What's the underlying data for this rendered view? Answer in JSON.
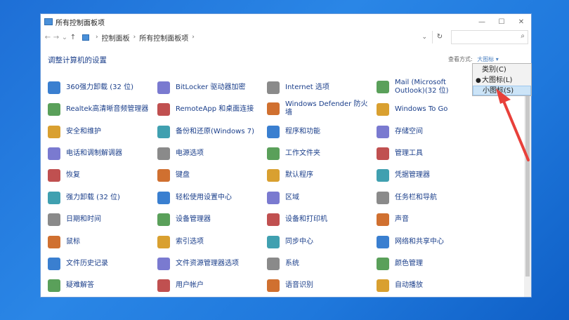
{
  "window": {
    "title": "所有控制面板项",
    "controls": {
      "minimize": "—",
      "maximize": "☐",
      "close": "✕"
    }
  },
  "address": {
    "crumbs": [
      "控制面板",
      "所有控制面板项"
    ],
    "separator": "›",
    "search_placeholder": ""
  },
  "content": {
    "heading": "调整计算机的设置",
    "view_by_label": "查看方式:",
    "view_by_value": "大图标 ▾"
  },
  "menu": {
    "items": [
      {
        "label": "类别(C)",
        "selected": false,
        "highlighted": false
      },
      {
        "label": "大图标(L)",
        "selected": true,
        "highlighted": false
      },
      {
        "label": "小图标(S)",
        "selected": false,
        "highlighted": true
      }
    ]
  },
  "items": [
    [
      "360强力卸载 (32 位)",
      "Realtek高清晰音频管理器",
      "安全和维护",
      "电话和调制解调器",
      "恢复",
      "强力卸载 (32 位)",
      "日期和时间",
      "鼠标",
      "文件历史记录",
      "疑难解答"
    ],
    [
      "BitLocker 驱动器加密",
      "RemoteApp 和桌面连接",
      "备份和还原(Windows 7)",
      "电源选项",
      "键盘",
      "轻松使用设置中心",
      "设备管理器",
      "索引选项",
      "文件资源管理器选项",
      "用户帐户"
    ],
    [
      "Internet 选项",
      "Windows Defender 防火墙",
      "程序和功能",
      "工作文件夹",
      "默认程序",
      "区域",
      "设备和打印机",
      "同步中心",
      "系统",
      "语音识别"
    ],
    [
      "Mail (Microsoft Outlook)(32 位)",
      "Windows To Go",
      "存储空间",
      "管理工具",
      "凭据管理器",
      "任务栏和导航",
      "声音",
      "网络和共享中心",
      "颜色管理",
      "自动播放"
    ]
  ],
  "icons": [
    [
      "uninstall-icon",
      "audio-icon",
      "flag-icon",
      "phone-icon",
      "recovery-icon",
      "uninstall-color-icon",
      "clock-icon",
      "mouse-icon",
      "file-history-icon",
      "troubleshoot-icon"
    ],
    [
      "bitlocker-icon",
      "remoteapp-icon",
      "backup-icon",
      "power-icon",
      "keyboard-icon",
      "ease-of-access-icon",
      "device-manager-icon",
      "index-icon",
      "folder-options-icon",
      "user-icon"
    ],
    [
      "internet-icon",
      "firewall-icon",
      "programs-icon",
      "work-folder-icon",
      "default-programs-icon",
      "region-icon",
      "printer-icon",
      "sync-icon",
      "system-icon",
      "speech-icon"
    ],
    [
      "mail-icon",
      "windows-to-go-icon",
      "storage-icon",
      "admin-tools-icon",
      "credential-icon",
      "taskbar-icon",
      "sound-icon",
      "network-icon",
      "color-icon",
      "autoplay-icon"
    ]
  ],
  "colors": {
    "accent": "#1a3e8a",
    "arrow": "#e8403a",
    "desktop": "#1f78dc"
  }
}
